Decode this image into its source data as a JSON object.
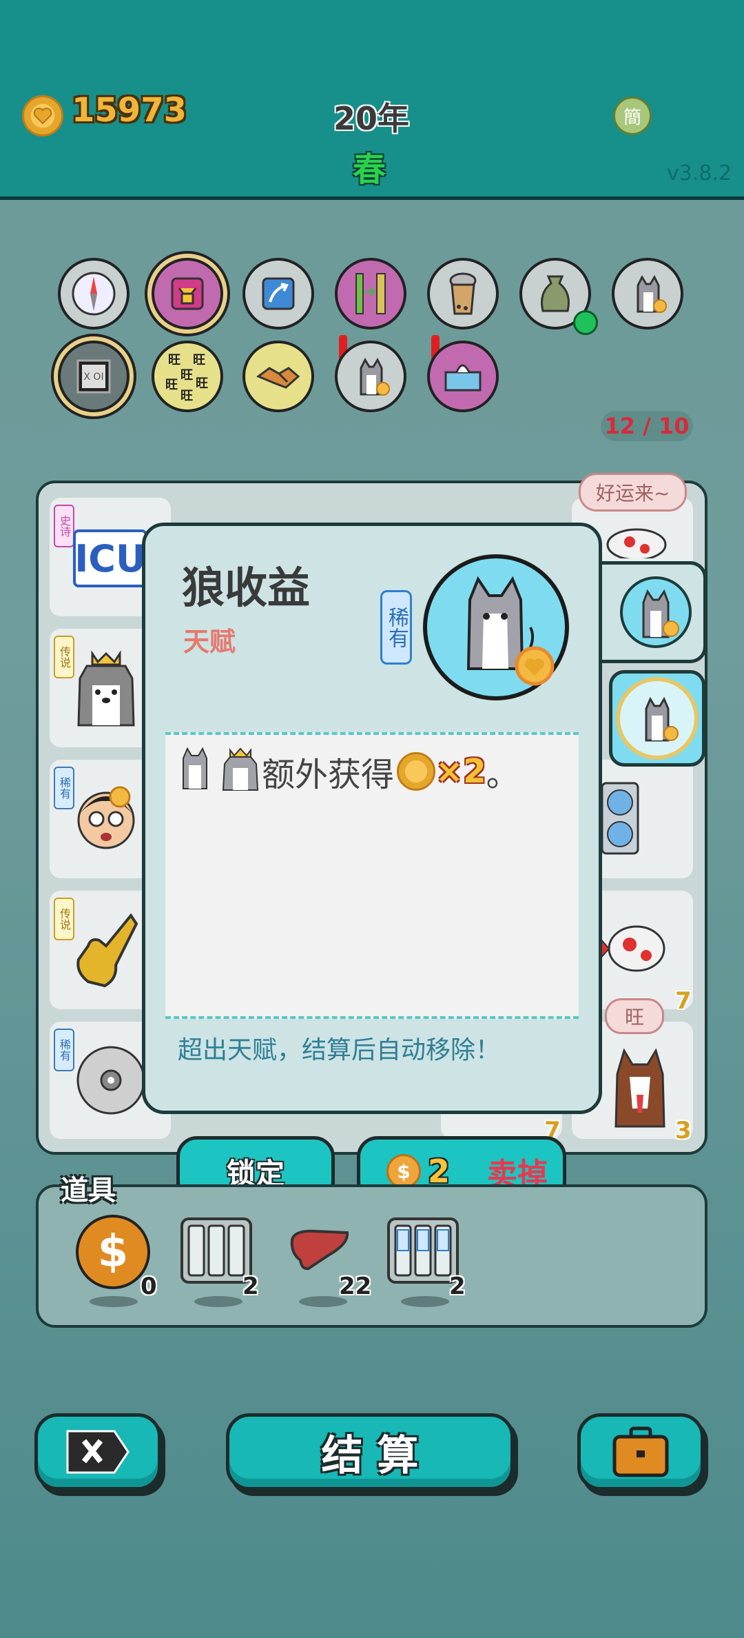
{
  "header": {
    "coins": "15973",
    "year": "20年",
    "season": "春",
    "lang_button": "簡",
    "version": "v3.8.2"
  },
  "relics": {
    "row1": [
      "compass-icon",
      "ox-card-icon",
      "arrow-card-icon",
      "bamboo-card-icon",
      "bubble-tea-icon",
      "money-bag-icon",
      "husky-coin-icon"
    ],
    "row2": [
      "xo-chip-icon",
      "wang-tiles-icon",
      "handshake-icon",
      "husky-coin-icon",
      "tissue-box-icon"
    ],
    "counter": "12 / 10"
  },
  "board": {
    "speech_good_luck": "好运来~",
    "speech_wang": "旺",
    "icu_label": "ICU",
    "tags": {
      "epic": "史诗",
      "legend": "传说",
      "rare": "稀有"
    },
    "counts": [
      "7",
      "7",
      "3"
    ]
  },
  "popup": {
    "title": "狼收益",
    "subtitle": "天赋",
    "rarity": "稀有",
    "desc_text": "额外获得",
    "multiplier": "×2",
    "period": "。",
    "footer": "超出天赋，结算后自动移除！",
    "lock_button": "锁定",
    "sell_price": "2",
    "sell_label": "卖掉"
  },
  "items": {
    "label": "道具",
    "list": [
      {
        "icon": "dollar-coin-icon",
        "count": "0"
      },
      {
        "icon": "triple-slot-icon",
        "count": "2"
      },
      {
        "icon": "liver-icon",
        "count": "22"
      },
      {
        "icon": "rare-slot-icon",
        "count": "2"
      }
    ]
  },
  "bottom": {
    "settle_label": "结 算"
  },
  "colors": {
    "topbar": "#17908b",
    "accent": "#1cc5c2",
    "popup_bg": "#cde3e4",
    "sell_text": "#e8384f",
    "subtitle": "#e57a6e"
  }
}
